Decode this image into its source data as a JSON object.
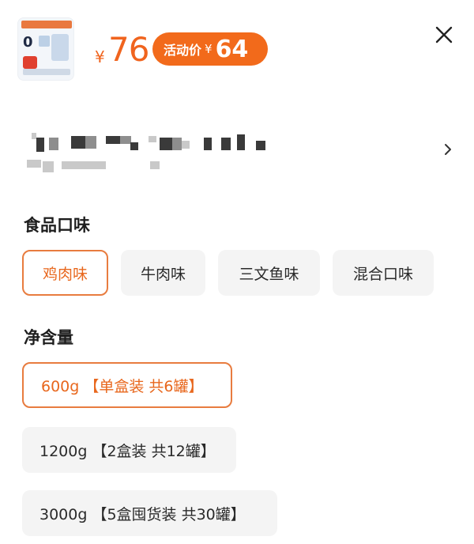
{
  "header": {
    "price_symbol": "¥",
    "price": "76",
    "promo_label": "活动价",
    "promo_symbol": "¥",
    "promo_price": "64",
    "accent_color": "#f26a1b"
  },
  "flavor": {
    "title": "食品口味",
    "options": [
      "鸡肉味",
      "牛肉味",
      "三文鱼味",
      "混合口味"
    ],
    "selected": "鸡肉味"
  },
  "size": {
    "title": "净含量",
    "options": [
      "600g 【单盒装 共6罐】",
      "1200g 【2盒装 共12罐】",
      "3000g 【5盒囤货装 共30罐】"
    ],
    "selected": "600g 【单盒装 共6罐】"
  }
}
